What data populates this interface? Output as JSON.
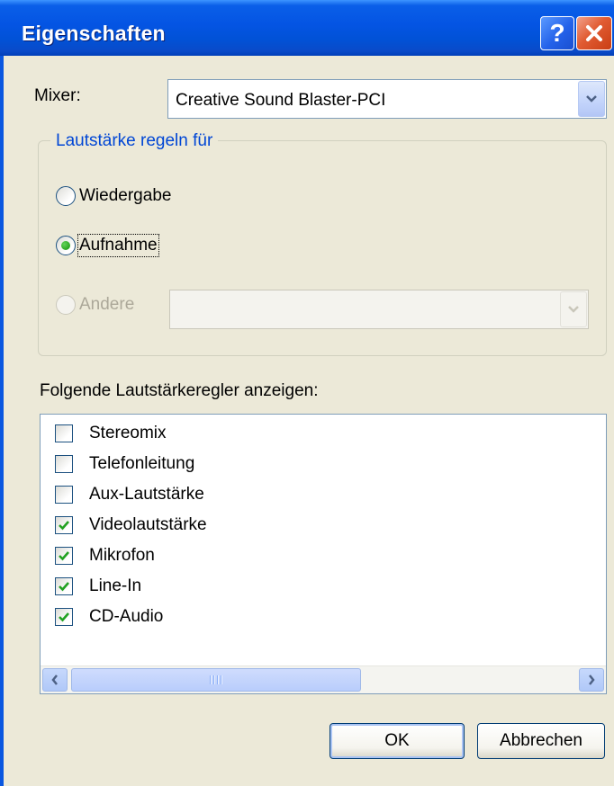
{
  "window": {
    "title": "Eigenschaften",
    "help_button": "?",
    "close_icon": "close-icon"
  },
  "mixer": {
    "label": "Mixer:",
    "selected_value": "Creative Sound Blaster-PCI"
  },
  "volume_group": {
    "title": "Lautstärke regeln für",
    "options": [
      {
        "label": "Wiedergabe",
        "checked": false,
        "enabled": true
      },
      {
        "label": "Aufnahme",
        "checked": true,
        "enabled": true
      },
      {
        "label": "Andere",
        "checked": false,
        "enabled": false
      }
    ],
    "other_combo_value": ""
  },
  "controls_list": {
    "label": "Folgende Lautstärkeregler anzeigen:",
    "items": [
      {
        "label": "Stereomix",
        "checked": false
      },
      {
        "label": "Telefonleitung",
        "checked": false
      },
      {
        "label": "Aux-Lautstärke",
        "checked": false
      },
      {
        "label": "Videolautstärke",
        "checked": true
      },
      {
        "label": "Mikrofon",
        "checked": true
      },
      {
        "label": "Line-In",
        "checked": true
      },
      {
        "label": "CD-Audio",
        "checked": true
      }
    ]
  },
  "buttons": {
    "ok": "OK",
    "cancel": "Abbrechen"
  },
  "colors": {
    "titlebar": "#0454e3",
    "dialog_bg": "#ece9d8",
    "group_title": "#0046d5",
    "checkmark": "#21a121",
    "close_button": "#e15c33"
  }
}
